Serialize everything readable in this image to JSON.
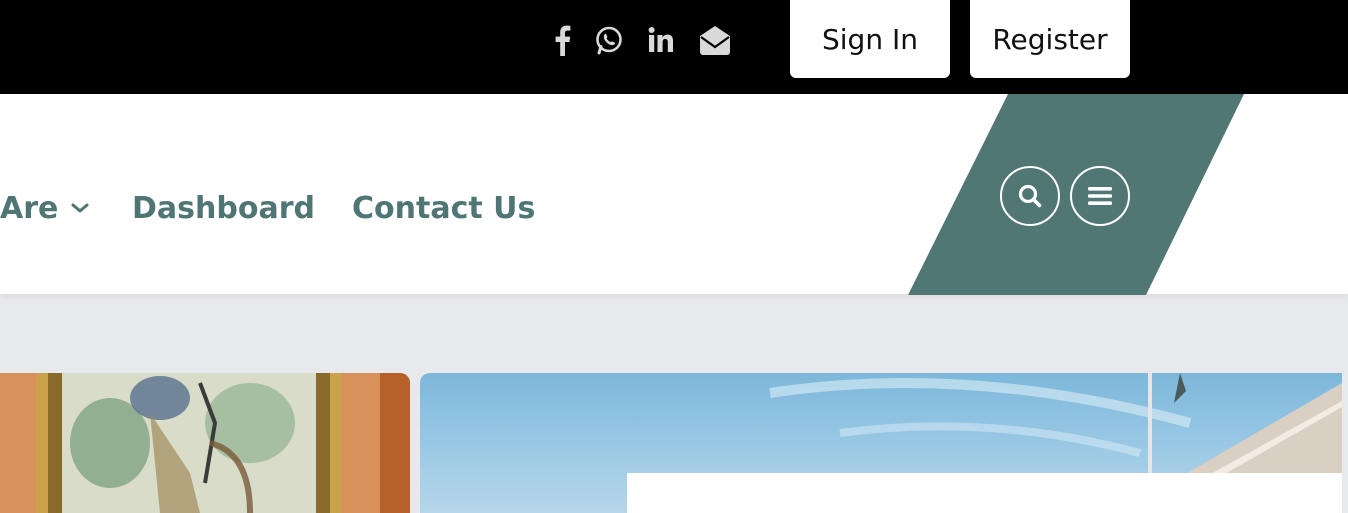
{
  "topbar": {
    "social_icons": [
      "facebook-icon",
      "whatsapp-icon",
      "linkedin-icon",
      "email-icon"
    ],
    "sign_in_label": "Sign In",
    "register_label": "Register"
  },
  "nav": {
    "items": [
      {
        "label": "Are",
        "has_dropdown": true
      },
      {
        "label": "Dashboard"
      },
      {
        "label": "Contact Us"
      }
    ],
    "search_icon": "search-icon",
    "menu_icon": "hamburger-menu-icon"
  },
  "colors": {
    "topbar_bg": "#000000",
    "accent_teal": "#517775",
    "nav_text": "#4f7674",
    "page_bg": "#e8e9ec"
  }
}
